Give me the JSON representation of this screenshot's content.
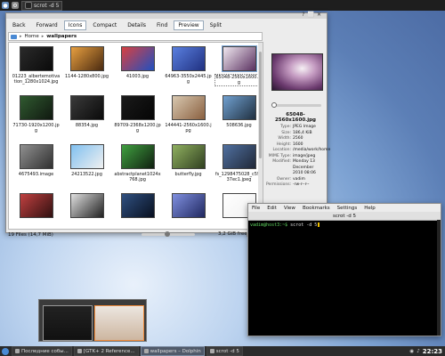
{
  "tray": {
    "task_title": "scrot -d 5"
  },
  "dolphin": {
    "toolbar": [
      "Back",
      "Forward",
      "Icons",
      "Compact",
      "Details",
      "Find",
      "Preview",
      "Split"
    ],
    "breadcrumb": [
      "Home",
      "wallpapers"
    ],
    "files": [
      {
        "name": "01223_albertemotivation_1280x1024.jpg",
        "colors": [
          "#2a2a2a",
          "#0a0a0a"
        ]
      },
      {
        "name": "1144-1280x800.jpg",
        "colors": [
          "#e8a040",
          "#4a2a10"
        ]
      },
      {
        "name": "41003.jpg",
        "colors": [
          "#d84040",
          "#2050c0"
        ]
      },
      {
        "name": "64963-3550x2445.jpg",
        "colors": [
          "#5a80e0",
          "#203080"
        ]
      },
      {
        "name": "65048-2560x1600.jpg",
        "colors": [
          "#f0e8f0",
          "#5a3060"
        ]
      },
      {
        "name": "71730-1920x1200.jpg",
        "colors": [
          "#305a30",
          "#101810"
        ]
      },
      {
        "name": "88354.jpg",
        "colors": [
          "#3a3a3a",
          "#0a0a0a"
        ]
      },
      {
        "name": "89709-2368x1200.jpg",
        "colors": [
          "#1a1a1a",
          "#050505"
        ]
      },
      {
        "name": "144441-2560x1600.jpg",
        "colors": [
          "#d8c8b0",
          "#8a6040"
        ]
      },
      {
        "name": "508636.jpg",
        "colors": [
          "#70a0d0",
          "#203040"
        ]
      },
      {
        "name": "4675493.image",
        "colors": [
          "#909090",
          "#303030"
        ]
      },
      {
        "name": "24213522.jpg",
        "colors": [
          "#80c0f0",
          "#f0f0f0"
        ]
      },
      {
        "name": "abstractplanet1024x768.jpg",
        "colors": [
          "#40a040",
          "#102010"
        ]
      },
      {
        "name": "butterfly.jpg",
        "colors": [
          "#90b060",
          "#304020"
        ]
      },
      {
        "name": "fs_1298475028_c59e37ec1.jpeg",
        "colors": [
          "#5070a0",
          "#202838"
        ]
      },
      {
        "name": "",
        "colors": [
          "#c04040",
          "#301010"
        ]
      },
      {
        "name": "",
        "colors": [
          "#e0e0e0",
          "#202020"
        ]
      },
      {
        "name": "",
        "colors": [
          "#305080",
          "#081020"
        ]
      },
      {
        "name": "",
        "colors": [
          "#8090e0",
          "#202860"
        ]
      },
      {
        "name": "",
        "colors": [
          "#ffffff",
          "#f0f0f0"
        ]
      }
    ],
    "status_text": "19 Files (14,7 MiB)",
    "disk_free": "3,2 GiB free",
    "disk_used_fraction": 0.7,
    "info": {
      "title": "65048-2560x1600.jpg",
      "props": [
        {
          "k": "Type:",
          "v": "JPEG Image"
        },
        {
          "k": "Size:",
          "v": "186,4 KiB"
        },
        {
          "k": "Width:",
          "v": "2560"
        },
        {
          "k": "Height:",
          "v": "1600"
        },
        {
          "k": "Location:",
          "v": "/media/work/home"
        },
        {
          "k": "MIME Type:",
          "v": "image/jpeg"
        },
        {
          "k": "Modified:",
          "v": "Monday 13 December 2010 08:06"
        },
        {
          "k": "Owner:",
          "v": "vadim"
        },
        {
          "k": "Permissions:",
          "v": "-rw-r--r--"
        }
      ]
    }
  },
  "terminal": {
    "menu": [
      "File",
      "Edit",
      "View",
      "Bookmarks",
      "Settings",
      "Help"
    ],
    "tab_title": "scrot -d 5",
    "prompt_user": "vadim@host3:~$",
    "command": " scrot -d 5"
  },
  "taskbar": {
    "tasks": [
      {
        "label": "Последние собы...",
        "active": false
      },
      {
        "label": "[GTK+ 2 Reference...",
        "active": false
      },
      {
        "label": "wallpapers – Dolphin",
        "active": true
      },
      {
        "label": "scrot -d 5",
        "active": false
      }
    ],
    "clock": "22:23"
  }
}
